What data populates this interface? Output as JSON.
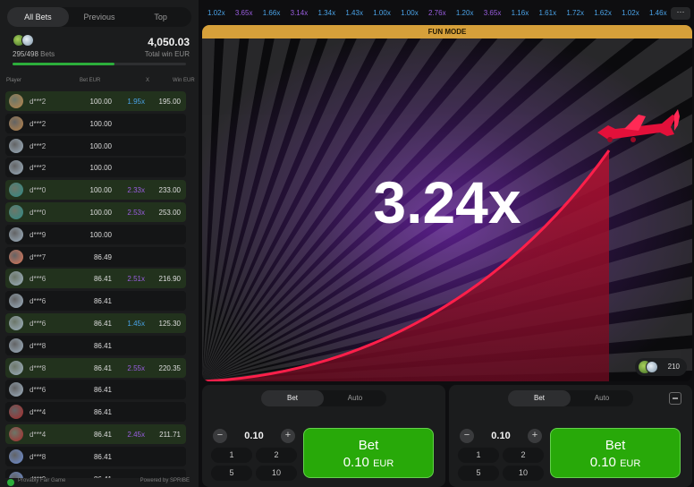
{
  "left_panel": {
    "tabs": [
      "All Bets",
      "Previous",
      "Top"
    ],
    "bets_count": "295/498",
    "bets_label": "Bets",
    "total_win": "4,050.03",
    "total_win_label": "Total win EUR",
    "progress_fraction": 0.59,
    "columns": [
      "Player",
      "Bet EUR",
      "X",
      "Win EUR"
    ],
    "rows": [
      {
        "player": "d***2",
        "bet": "100.00",
        "x": "1.95x",
        "win": "195.00",
        "win_row": true,
        "x_color": "blue",
        "avatar": "#b9854a"
      },
      {
        "player": "d***2",
        "bet": "100.00",
        "x": "",
        "win": "",
        "win_row": false,
        "x_color": "",
        "avatar": "#b9854a"
      },
      {
        "player": "d***2",
        "bet": "100.00",
        "x": "",
        "win": "",
        "win_row": false,
        "x_color": "",
        "avatar": "#9fb2c2"
      },
      {
        "player": "d***2",
        "bet": "100.00",
        "x": "",
        "win": "",
        "win_row": false,
        "x_color": "",
        "avatar": "#9fb2c2"
      },
      {
        "player": "d***0",
        "bet": "100.00",
        "x": "2.33x",
        "win": "233.00",
        "win_row": true,
        "x_color": "purple",
        "avatar": "#2d8a86"
      },
      {
        "player": "d***0",
        "bet": "100.00",
        "x": "2.53x",
        "win": "253.00",
        "win_row": true,
        "x_color": "purple",
        "avatar": "#2d8a86"
      },
      {
        "player": "d***9",
        "bet": "100.00",
        "x": "",
        "win": "",
        "win_row": false,
        "x_color": "",
        "avatar": "#9fb2c2"
      },
      {
        "player": "d***7",
        "bet": "86.49",
        "x": "",
        "win": "",
        "win_row": false,
        "x_color": "",
        "avatar": "#e0785a"
      },
      {
        "player": "d***6",
        "bet": "86.41",
        "x": "2.51x",
        "win": "216.90",
        "win_row": true,
        "x_color": "purple",
        "avatar": "#9fb2c2"
      },
      {
        "player": "d***6",
        "bet": "86.41",
        "x": "",
        "win": "",
        "win_row": false,
        "x_color": "",
        "avatar": "#9fb2c2"
      },
      {
        "player": "d***6",
        "bet": "86.41",
        "x": "1.45x",
        "win": "125.30",
        "win_row": true,
        "x_color": "blue",
        "avatar": "#9fb2c2"
      },
      {
        "player": "d***8",
        "bet": "86.41",
        "x": "",
        "win": "",
        "win_row": false,
        "x_color": "",
        "avatar": "#9fb2c2"
      },
      {
        "player": "d***8",
        "bet": "86.41",
        "x": "2.55x",
        "win": "220.35",
        "win_row": true,
        "x_color": "purple",
        "avatar": "#9fb2c2"
      },
      {
        "player": "d***6",
        "bet": "86.41",
        "x": "",
        "win": "",
        "win_row": false,
        "x_color": "",
        "avatar": "#9fb2c2"
      },
      {
        "player": "d***4",
        "bet": "86.41",
        "x": "",
        "win": "",
        "win_row": false,
        "x_color": "",
        "avatar": "#a82a2a"
      },
      {
        "player": "d***4",
        "bet": "86.41",
        "x": "2.45x",
        "win": "211.71",
        "win_row": true,
        "x_color": "purple",
        "avatar": "#a82a2a"
      },
      {
        "player": "d***8",
        "bet": "86.41",
        "x": "",
        "win": "",
        "win_row": false,
        "x_color": "",
        "avatar": "#6d8fd6"
      },
      {
        "player": "d***9",
        "bet": "86.41",
        "x": "",
        "win": "",
        "win_row": false,
        "x_color": "",
        "avatar": "#6d8fd6"
      }
    ],
    "footer_left": "Provably Fair Game",
    "footer_right": "Powered by SPRIBE"
  },
  "history": [
    {
      "v": "1.02x",
      "c": "blue"
    },
    {
      "v": "3.65x",
      "c": "purple"
    },
    {
      "v": "1.66x",
      "c": "blue"
    },
    {
      "v": "3.14x",
      "c": "purple"
    },
    {
      "v": "1.34x",
      "c": "blue"
    },
    {
      "v": "1.43x",
      "c": "blue"
    },
    {
      "v": "1.00x",
      "c": "blue"
    },
    {
      "v": "1.00x",
      "c": "blue"
    },
    {
      "v": "2.76x",
      "c": "purple"
    },
    {
      "v": "1.20x",
      "c": "blue"
    },
    {
      "v": "3.65x",
      "c": "purple"
    },
    {
      "v": "1.16x",
      "c": "blue"
    },
    {
      "v": "1.61x",
      "c": "blue"
    },
    {
      "v": "1.72x",
      "c": "blue"
    },
    {
      "v": "1.62x",
      "c": "blue"
    },
    {
      "v": "1.02x",
      "c": "blue"
    },
    {
      "v": "1.46x",
      "c": "blue"
    }
  ],
  "game": {
    "mode_banner": "FUN MODE",
    "multiplier": "3.24x",
    "online_count": "210"
  },
  "bet_panels": [
    {
      "tab_bet": "Bet",
      "tab_auto": "Auto",
      "amount": "0.10",
      "quick": [
        "1",
        "2",
        "5",
        "10"
      ],
      "button_label": "Bet",
      "button_amount": "0.10",
      "currency": "EUR"
    },
    {
      "tab_bet": "Bet",
      "tab_auto": "Auto",
      "amount": "0.10",
      "quick": [
        "1",
        "2",
        "5",
        "10"
      ],
      "button_label": "Bet",
      "button_amount": "0.10",
      "currency": "EUR"
    }
  ],
  "colors": {
    "accent_green": "#28a909",
    "blue_mult": "#4aa3e8",
    "purple_mult": "#9a5ee0",
    "curve": "#e3103a",
    "banner": "#d6a03a"
  },
  "icons": {
    "more": "ellipsis-icon",
    "minimize": "minimize-icon",
    "plane": "airplane-icon"
  }
}
